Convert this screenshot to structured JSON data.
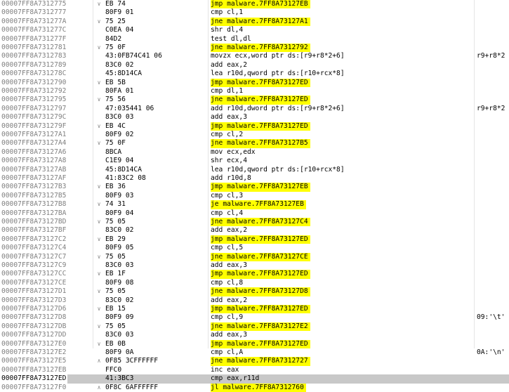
{
  "colors": {
    "highlight": "#ffff00",
    "current_row": "#c8c8c8",
    "address_text": "#808080"
  },
  "rows": [
    {
      "addr": "00007FF8A7312775",
      "arrow": "v",
      "bytes": "EB 74",
      "instr": "jmp malware.7FF8A73127EB",
      "hl": true,
      "comment": ""
    },
    {
      "addr": "00007FF8A7312777",
      "arrow": "",
      "bytes": "80F9 01",
      "instr": "cmp cl,1",
      "hl": false,
      "comment": ""
    },
    {
      "addr": "00007FF8A731277A",
      "arrow": "v",
      "bytes": "75 25",
      "instr": "jne malware.7FF8A73127A1",
      "hl": true,
      "comment": ""
    },
    {
      "addr": "00007FF8A731277C",
      "arrow": "",
      "bytes": "C0EA 04",
      "instr": "shr dl,4",
      "hl": false,
      "comment": ""
    },
    {
      "addr": "00007FF8A731277F",
      "arrow": "",
      "bytes": "84D2",
      "instr": "test dl,dl",
      "hl": false,
      "comment": ""
    },
    {
      "addr": "00007FF8A7312781",
      "arrow": "v",
      "bytes": "75 0F",
      "instr": "jne malware.7FF8A7312792",
      "hl": true,
      "comment": ""
    },
    {
      "addr": "00007FF8A7312783",
      "arrow": "",
      "bytes": "43:0FB74C41 06",
      "instr": "movzx ecx,word ptr ds:[r9+r8*2+6]",
      "hl": false,
      "comment": "r9+r8*2"
    },
    {
      "addr": "00007FF8A7312789",
      "arrow": "",
      "bytes": "83C0 02",
      "instr": "add eax,2",
      "hl": false,
      "comment": ""
    },
    {
      "addr": "00007FF8A731278C",
      "arrow": "",
      "bytes": "45:8D14CA",
      "instr": "lea r10d,qword ptr ds:[r10+rcx*8]",
      "hl": false,
      "comment": ""
    },
    {
      "addr": "00007FF8A7312790",
      "arrow": "v",
      "bytes": "EB 5B",
      "instr": "jmp malware.7FF8A73127ED",
      "hl": true,
      "comment": ""
    },
    {
      "addr": "00007FF8A7312792",
      "arrow": "",
      "bytes": "80FA 01",
      "instr": "cmp dl,1",
      "hl": false,
      "comment": ""
    },
    {
      "addr": "00007FF8A7312795",
      "arrow": "v",
      "bytes": "75 56",
      "instr": "jne malware.7FF8A73127ED",
      "hl": true,
      "comment": ""
    },
    {
      "addr": "00007FF8A7312797",
      "arrow": "",
      "bytes": "47:035441 06",
      "instr": "add r10d,dword ptr ds:[r9+r8*2+6]",
      "hl": false,
      "comment": "r9+r8*2"
    },
    {
      "addr": "00007FF8A731279C",
      "arrow": "",
      "bytes": "83C0 03",
      "instr": "add eax,3",
      "hl": false,
      "comment": ""
    },
    {
      "addr": "00007FF8A731279F",
      "arrow": "v",
      "bytes": "EB 4C",
      "instr": "jmp malware.7FF8A73127ED",
      "hl": true,
      "comment": ""
    },
    {
      "addr": "00007FF8A73127A1",
      "arrow": "",
      "bytes": "80F9 02",
      "instr": "cmp cl,2",
      "hl": false,
      "comment": ""
    },
    {
      "addr": "00007FF8A73127A4",
      "arrow": "v",
      "bytes": "75 0F",
      "instr": "jne malware.7FF8A73127B5",
      "hl": true,
      "comment": ""
    },
    {
      "addr": "00007FF8A73127A6",
      "arrow": "",
      "bytes": "8BCA",
      "instr": "mov ecx,edx",
      "hl": false,
      "comment": ""
    },
    {
      "addr": "00007FF8A73127A8",
      "arrow": "",
      "bytes": "C1E9 04",
      "instr": "shr ecx,4",
      "hl": false,
      "comment": ""
    },
    {
      "addr": "00007FF8A73127AB",
      "arrow": "",
      "bytes": "45:8D14CA",
      "instr": "lea r10d,qword ptr ds:[r10+rcx*8]",
      "hl": false,
      "comment": ""
    },
    {
      "addr": "00007FF8A73127AF",
      "arrow": "",
      "bytes": "41:83C2 08",
      "instr": "add r10d,8",
      "hl": false,
      "comment": ""
    },
    {
      "addr": "00007FF8A73127B3",
      "arrow": "v",
      "bytes": "EB 36",
      "instr": "jmp malware.7FF8A73127EB",
      "hl": true,
      "comment": ""
    },
    {
      "addr": "00007FF8A73127B5",
      "arrow": "",
      "bytes": "80F9 03",
      "instr": "cmp cl,3",
      "hl": false,
      "comment": ""
    },
    {
      "addr": "00007FF8A73127B8",
      "arrow": "v",
      "bytes": "74 31",
      "instr": "je malware.7FF8A73127EB",
      "hl": true,
      "comment": ""
    },
    {
      "addr": "00007FF8A73127BA",
      "arrow": "",
      "bytes": "80F9 04",
      "instr": "cmp cl,4",
      "hl": false,
      "comment": ""
    },
    {
      "addr": "00007FF8A73127BD",
      "arrow": "v",
      "bytes": "75 05",
      "instr": "jne malware.7FF8A73127C4",
      "hl": true,
      "comment": ""
    },
    {
      "addr": "00007FF8A73127BF",
      "arrow": "",
      "bytes": "83C0 02",
      "instr": "add eax,2",
      "hl": false,
      "comment": ""
    },
    {
      "addr": "00007FF8A73127C2",
      "arrow": "v",
      "bytes": "EB 29",
      "instr": "jmp malware.7FF8A73127ED",
      "hl": true,
      "comment": ""
    },
    {
      "addr": "00007FF8A73127C4",
      "arrow": "",
      "bytes": "80F9 05",
      "instr": "cmp cl,5",
      "hl": false,
      "comment": ""
    },
    {
      "addr": "00007FF8A73127C7",
      "arrow": "v",
      "bytes": "75 05",
      "instr": "jne malware.7FF8A73127CE",
      "hl": true,
      "comment": ""
    },
    {
      "addr": "00007FF8A73127C9",
      "arrow": "",
      "bytes": "83C0 03",
      "instr": "add eax,3",
      "hl": false,
      "comment": ""
    },
    {
      "addr": "00007FF8A73127CC",
      "arrow": "v",
      "bytes": "EB 1F",
      "instr": "jmp malware.7FF8A73127ED",
      "hl": true,
      "comment": ""
    },
    {
      "addr": "00007FF8A73127CE",
      "arrow": "",
      "bytes": "80F9 08",
      "instr": "cmp cl,8",
      "hl": false,
      "comment": ""
    },
    {
      "addr": "00007FF8A73127D1",
      "arrow": "v",
      "bytes": "75 05",
      "instr": "jne malware.7FF8A73127D8",
      "hl": true,
      "comment": ""
    },
    {
      "addr": "00007FF8A73127D3",
      "arrow": "",
      "bytes": "83C0 02",
      "instr": "add eax,2",
      "hl": false,
      "comment": ""
    },
    {
      "addr": "00007FF8A73127D6",
      "arrow": "v",
      "bytes": "EB 15",
      "instr": "jmp malware.7FF8A73127ED",
      "hl": true,
      "comment": ""
    },
    {
      "addr": "00007FF8A73127D8",
      "arrow": "",
      "bytes": "80F9 09",
      "instr": "cmp cl,9",
      "hl": false,
      "comment": "09:'\\t'"
    },
    {
      "addr": "00007FF8A73127DB",
      "arrow": "v",
      "bytes": "75 05",
      "instr": "jne malware.7FF8A73127E2",
      "hl": true,
      "comment": ""
    },
    {
      "addr": "00007FF8A73127DD",
      "arrow": "",
      "bytes": "83C0 03",
      "instr": "add eax,3",
      "hl": false,
      "comment": ""
    },
    {
      "addr": "00007FF8A73127E0",
      "arrow": "v",
      "bytes": "EB 0B",
      "instr": "jmp malware.7FF8A73127ED",
      "hl": true,
      "comment": ""
    },
    {
      "addr": "00007FF8A73127E2",
      "arrow": "",
      "bytes": "80F9 0A",
      "instr": "cmp cl,A",
      "hl": false,
      "comment": "0A:'\\n'"
    },
    {
      "addr": "00007FF8A73127E5",
      "arrow": "^",
      "bytes": "0F85 3CFFFFFF",
      "instr": "jne malware.7FF8A7312727",
      "hl": true,
      "comment": ""
    },
    {
      "addr": "00007FF8A73127EB",
      "arrow": "",
      "bytes": "FFC0",
      "instr": "inc eax",
      "hl": false,
      "comment": ""
    },
    {
      "addr": "00007FF8A73127ED",
      "arrow": "",
      "bytes": "41:3BC3",
      "instr": "cmp eax,r11d",
      "hl": false,
      "comment": "",
      "current": true
    },
    {
      "addr": "00007FF8A73127F0",
      "arrow": "^",
      "bytes": "0F8C 6AFFFFFF",
      "instr": "jl malware.7FF8A7312760",
      "hl": true,
      "comment": ""
    }
  ]
}
